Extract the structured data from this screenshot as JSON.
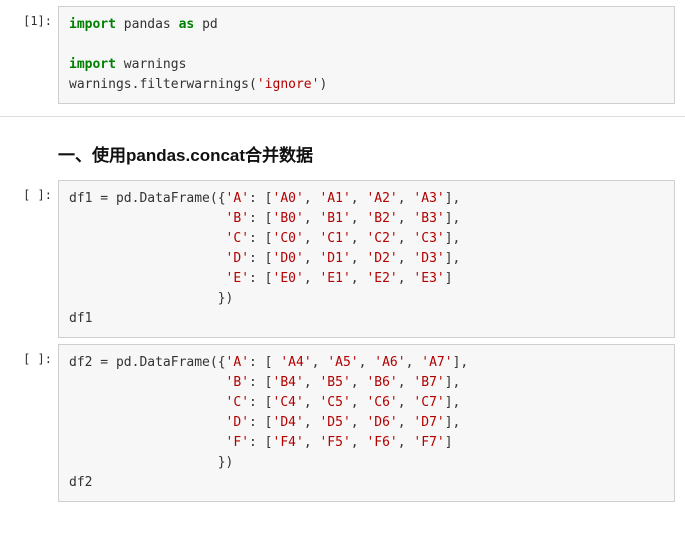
{
  "cells": {
    "c1": {
      "prompt": "[1]:",
      "code": {
        "l1": {
          "kw": "import",
          "rest": " pandas ",
          "kw2": "as",
          "rest2": " pd"
        },
        "l3": {
          "kw": "import",
          "rest": " warnings"
        },
        "l4": {
          "pre": "warnings.filterwarnings(",
          "str": "'ignore'",
          "post": ")"
        }
      }
    },
    "heading": "一、使用pandas.concat合并数据",
    "c2": {
      "prompt": "[ ]:",
      "var": "df1",
      "head": "df1 = pd.DataFrame({",
      "rows": [
        {
          "key": "'A'",
          "vals": [
            "'A0'",
            "'A1'",
            "'A2'",
            "'A3'"
          ],
          "end": ","
        },
        {
          "key": "'B'",
          "vals": [
            "'B0'",
            "'B1'",
            "'B2'",
            "'B3'"
          ],
          "end": ","
        },
        {
          "key": "'C'",
          "vals": [
            "'C0'",
            "'C1'",
            "'C2'",
            "'C3'"
          ],
          "end": ","
        },
        {
          "key": "'D'",
          "vals": [
            "'D0'",
            "'D1'",
            "'D2'",
            "'D3'"
          ],
          "end": ","
        },
        {
          "key": "'E'",
          "vals": [
            "'E0'",
            "'E1'",
            "'E2'",
            "'E3'"
          ],
          "end": ""
        }
      ],
      "close": "                   })",
      "trail": "df1"
    },
    "c3": {
      "prompt": "[ ]:",
      "var": "df2",
      "head": "df2 = pd.DataFrame({",
      "rows": [
        {
          "key": "'A'",
          "vals": [
            "'A4'",
            "'A5'",
            "'A6'",
            "'A7'"
          ],
          "end": ","
        },
        {
          "key": "'B'",
          "vals": [
            "'B4'",
            "'B5'",
            "'B6'",
            "'B7'"
          ],
          "end": ","
        },
        {
          "key": "'C'",
          "vals": [
            "'C4'",
            "'C5'",
            "'C6'",
            "'C7'"
          ],
          "end": ","
        },
        {
          "key": "'D'",
          "vals": [
            "'D4'",
            "'D5'",
            "'D6'",
            "'D7'"
          ],
          "end": ","
        },
        {
          "key": "'F'",
          "vals": [
            "'F4'",
            "'F5'",
            "'F6'",
            "'F7'"
          ],
          "end": ""
        }
      ],
      "close": "                   })",
      "trail": "df2"
    }
  }
}
